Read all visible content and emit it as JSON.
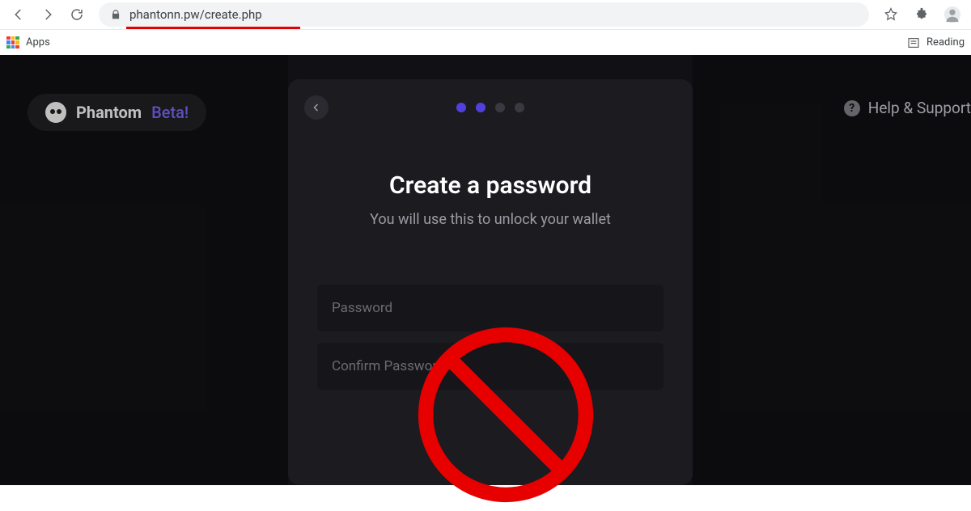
{
  "browser": {
    "url": "phantonn.pw/create.php",
    "bookmarks": {
      "apps": "Apps",
      "reading": "Reading"
    }
  },
  "topbar": {
    "brand_name": "Phantom",
    "brand_suffix": "Beta!",
    "help_label": "Help & Support"
  },
  "card": {
    "title": "Create a password",
    "subtitle": "You will use this to unlock your wallet",
    "password_placeholder": "Password",
    "confirm_placeholder": "Confirm Password",
    "step_active_1": true,
    "step_active_2": true
  }
}
